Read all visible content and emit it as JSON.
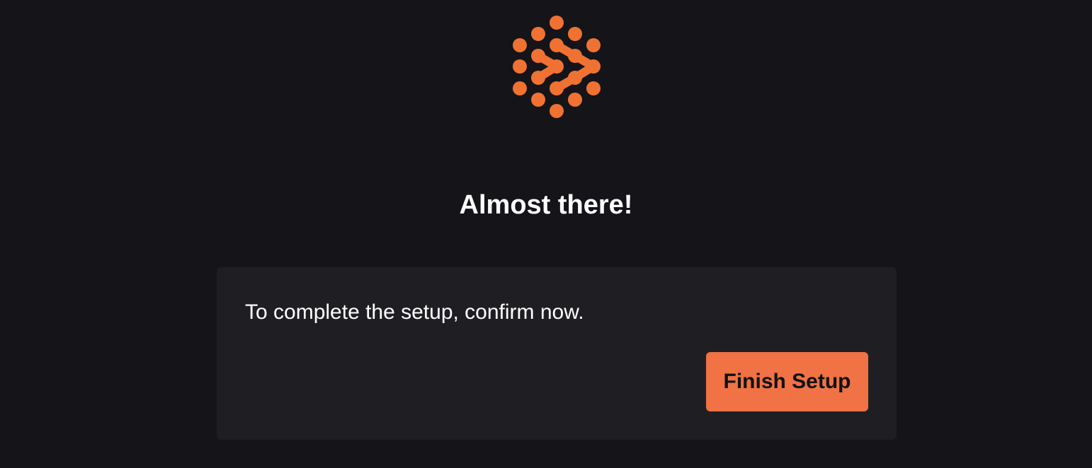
{
  "logo": {
    "icon": "dots-logo-icon",
    "color": "#f07232"
  },
  "heading": {
    "text": "Almost there!"
  },
  "card": {
    "message": "To complete the setup, confirm now.",
    "finish_label": "Finish Setup"
  },
  "colors": {
    "background": "#151419",
    "card": "#1f1f23",
    "accent": "#f07245"
  }
}
